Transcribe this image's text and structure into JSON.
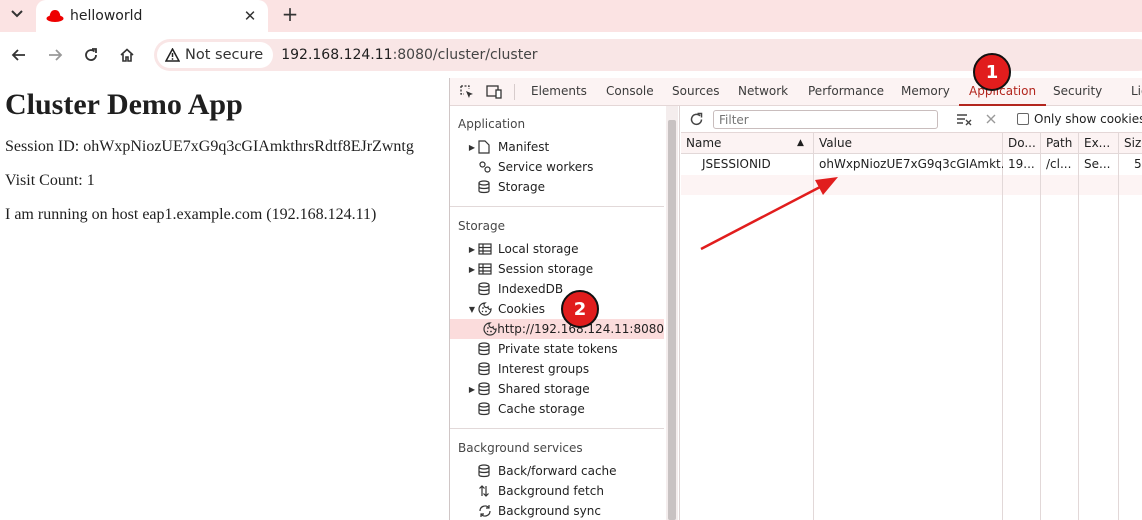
{
  "browser": {
    "tab_title": "helloworld",
    "security_label": "Not secure",
    "url_host": "192.168.124.11",
    "url_rest": ":8080/cluster/cluster",
    "accent_color": "#b3261e"
  },
  "page": {
    "heading": "Cluster Demo App",
    "session_line": "Session ID: ohWxpNiozUE7xG9q3cGIAmkthrsRdtf8EJrZwntg",
    "visit_line": "Visit Count: 1",
    "host_line": "I am running on host eap1.example.com (192.168.124.11)"
  },
  "devtools": {
    "tabs": [
      "Elements",
      "Console",
      "Sources",
      "Network",
      "Performance",
      "Memory",
      "Application",
      "Security",
      "Lig"
    ],
    "active_tab": "Application",
    "sidebar": {
      "application_header": "Application",
      "application_items": [
        "Manifest",
        "Service workers",
        "Storage"
      ],
      "storage_header": "Storage",
      "storage_items": [
        "Local storage",
        "Session storage",
        "IndexedDB",
        "Cookies",
        "http://192.168.124.11:8080",
        "Private state tokens",
        "Interest groups",
        "Shared storage",
        "Cache storage"
      ],
      "background_header": "Background services",
      "background_items": [
        "Back/forward cache",
        "Background fetch",
        "Background sync"
      ]
    },
    "cookies": {
      "filter_placeholder": "Filter",
      "only_show_label": "Only show cookies wi",
      "columns": [
        "Name",
        "Value",
        "Do...",
        "Path",
        "Ex...",
        "Size"
      ],
      "rows": [
        [
          "JSESSIONID",
          "ohWxpNiozUE7xG9q3cGIAmkt...",
          "19...",
          "/cl...",
          "Se...",
          "5"
        ]
      ]
    }
  },
  "annotations": {
    "badge_1": "1",
    "badge_2": "2",
    "badge_color": "#e11d1d"
  }
}
